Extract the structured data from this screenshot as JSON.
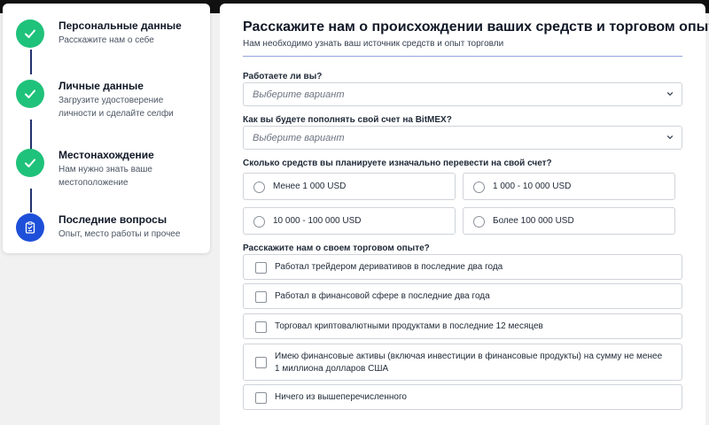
{
  "steps": [
    {
      "title": "Персональные данные",
      "subtitle": "Расскажите нам о себе",
      "status": "done",
      "icon": "check-icon"
    },
    {
      "title": "Личные данные",
      "subtitle": "Загрузите удостоверение личности и сделайте селфи",
      "status": "done",
      "icon": "check-icon"
    },
    {
      "title": "Местонахождение",
      "subtitle": "Нам нужно знать ваше местоположение",
      "status": "done",
      "icon": "check-icon"
    },
    {
      "title": "Последние вопросы",
      "subtitle": "Опыт, место работы и прочее",
      "status": "active",
      "icon": "clipboard-icon"
    }
  ],
  "form": {
    "title": "Расскажите нам о происхождении ваших средств и торговом опыте",
    "subtitle": "Нам необходимо узнать ваш источник средств и опыт торговли",
    "q1": {
      "label": "Работаете ли вы?",
      "placeholder": "Выберите вариант"
    },
    "q2": {
      "label": "Как вы будете пополнять свой счет на BitMEX?",
      "placeholder": "Выберите вариант"
    },
    "q3": {
      "label": "Сколько средств вы планируете изначально перевести на свой счет?",
      "options": [
        "Менее 1 000 USD",
        "1 000 - 10 000 USD",
        "10 000 - 100 000 USD",
        "Более 100 000 USD"
      ]
    },
    "q4": {
      "label": "Расскажите нам о своем торговом опыте?",
      "options": [
        "Работал трейдером деривативов в последние два года",
        "Работал в финансовой сфере в последние два года",
        "Торговал криптовалютными продуктами в последние 12 месяцев",
        "Имею финансовые активы (включая инвестиции в финансовые продукты) на сумму не менее 1 миллиона долларов США",
        "Ничего из вышеперечисленного"
      ]
    }
  },
  "colors": {
    "done": "#1fc27a",
    "active": "#1e4fd8",
    "connector": "#23326e"
  }
}
